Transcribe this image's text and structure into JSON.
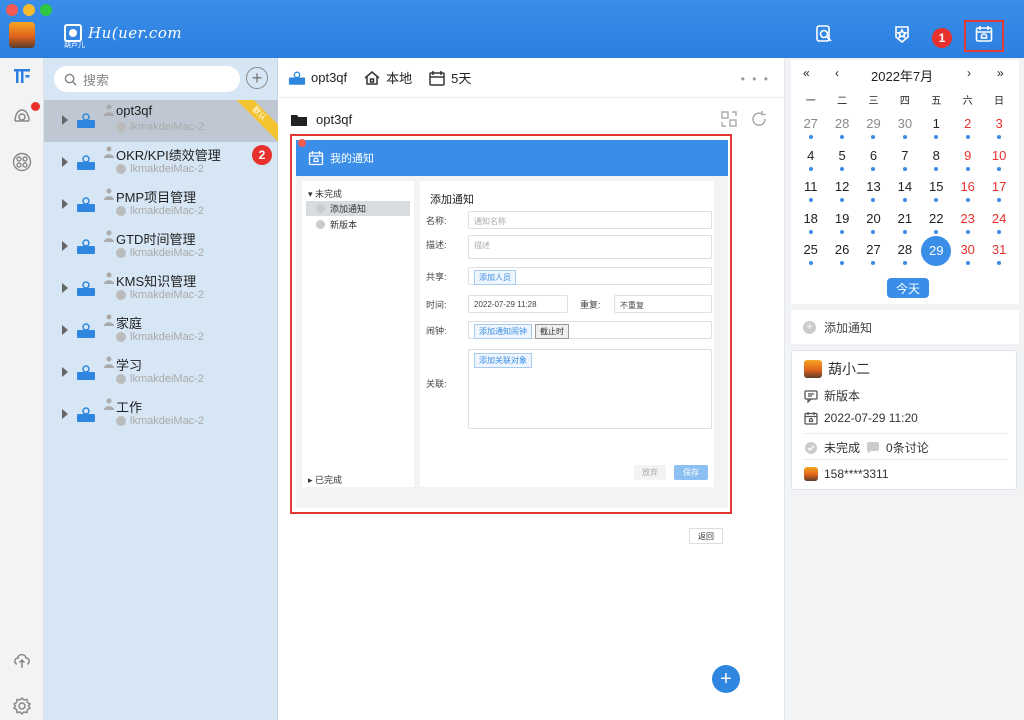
{
  "header": {
    "logo_text": "Hu(uer.com",
    "logo_sub": "葫芦儿",
    "badge_1": "1",
    "badge_2": "2"
  },
  "sidebar": {
    "search_placeholder": "搜索",
    "items": [
      {
        "title": "opt3qf",
        "sub": "lkmakdeiMac-2",
        "tag": "默认"
      },
      {
        "title": "OKR/KPI绩效管理",
        "sub": "lkmakdeiMac-2"
      },
      {
        "title": "PMP项目管理",
        "sub": "lkmakdeiMac-2"
      },
      {
        "title": "GTD时间管理",
        "sub": "lkmakdeiMac-2"
      },
      {
        "title": "KMS知识管理",
        "sub": "lkmakdeiMac-2"
      },
      {
        "title": "家庭",
        "sub": "lkmakdeiMac-2"
      },
      {
        "title": "学习",
        "sub": "lkmakdeiMac-2"
      },
      {
        "title": "工作",
        "sub": "lkmakdeiMac-2"
      }
    ]
  },
  "main": {
    "toolbar": {
      "repo": "opt3qf",
      "location": "本地",
      "days": "5天",
      "more": "• • •"
    },
    "folder": "opt3qf",
    "fab": "+"
  },
  "preview": {
    "title": "我的通知",
    "left_group_open": "▾ 未完成",
    "left_items": [
      "添加通知",
      "新版本"
    ],
    "left_group_done": "▸ 已完成",
    "form_title": "添加通知",
    "name_label": "名称:",
    "name_placeholder": "通知名称",
    "desc_label": "描述:",
    "desc_placeholder": "描述",
    "share_label": "共享:",
    "share_tag": "添加人员",
    "time_label": "时间:",
    "time_value": "2022-07-29 11:28",
    "repeat_label": "重复:",
    "repeat_value": "不重复",
    "alarm_label": "闹钟:",
    "alarm_tag": "添加通知闹钟",
    "alarm_deadline": "截止时",
    "link_label": "关联:",
    "link_tag": "添加关联对象",
    "discard_btn": "放弃",
    "save_btn": "保存",
    "back_btn": "返回"
  },
  "calendar": {
    "nav_prev_year": "«",
    "nav_prev_month": "‹",
    "month_label": "2022年7月",
    "nav_next_month": "›",
    "nav_next_year": "»",
    "weekdays": [
      "一",
      "二",
      "三",
      "四",
      "五",
      "六",
      "日"
    ],
    "weeks": [
      [
        "27",
        "28",
        "29",
        "30",
        "1",
        "2",
        "3"
      ],
      [
        "4",
        "5",
        "6",
        "7",
        "8",
        "9",
        "10"
      ],
      [
        "11",
        "12",
        "13",
        "14",
        "15",
        "16",
        "17"
      ],
      [
        "18",
        "19",
        "20",
        "21",
        "22",
        "23",
        "24"
      ],
      [
        "25",
        "26",
        "27",
        "28",
        "29",
        "30",
        "31"
      ]
    ],
    "selected": "29",
    "today_btn": "今天"
  },
  "notify": {
    "add_label": "添加通知",
    "card": {
      "user": "葫小二",
      "title": "新版本",
      "time": "2022-07-29 11:20",
      "status": "未完成",
      "comments": "0条讨论",
      "phone": "158****3311"
    }
  },
  "colors": {
    "primary": "#3a8ee8",
    "sidebar_bg": "#d6e6f5",
    "weekend": "#e8302c",
    "highlight": "#e23a33"
  }
}
